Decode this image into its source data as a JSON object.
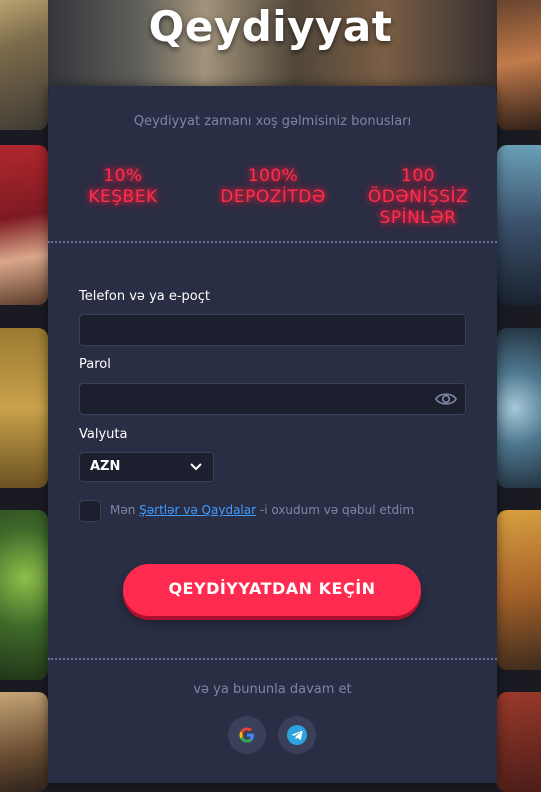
{
  "page": {
    "title": "Qeydiyyat"
  },
  "card": {
    "welcome_text": "Qeydiyyat zamanı xoş gəlmisiniz bonusları",
    "bonuses": [
      {
        "line1": "10%",
        "line2": "KEŞBEK"
      },
      {
        "line1": "100%",
        "line2": "DEPOZİTDƏ"
      },
      {
        "line1": "100",
        "line2": "ÖDƏNİŞSİZ SPİNLƏR"
      }
    ],
    "fields": {
      "login_label": "Telefon və ya e-poçt",
      "login_value": "",
      "password_label": "Parol",
      "password_value": "",
      "currency_label": "Valyuta",
      "currency_value": "AZN"
    },
    "terms": {
      "prefix": "Mən ",
      "link": "Şərtlər və Qaydalar",
      "suffix": " -i oxudum və qəbul etdim"
    },
    "submit_label": "QEYDİYYATDAN KEÇİN",
    "continue_text": "və ya bununla davam et"
  },
  "icons": [
    "eye-icon",
    "chevron-down-icon",
    "google-icon",
    "telegram-icon"
  ],
  "colors": {
    "accent": "#ff2a4f",
    "bonus_glow": "#ff2e4d",
    "card_bg": "#2a2e44",
    "link": "#3f9dff"
  }
}
